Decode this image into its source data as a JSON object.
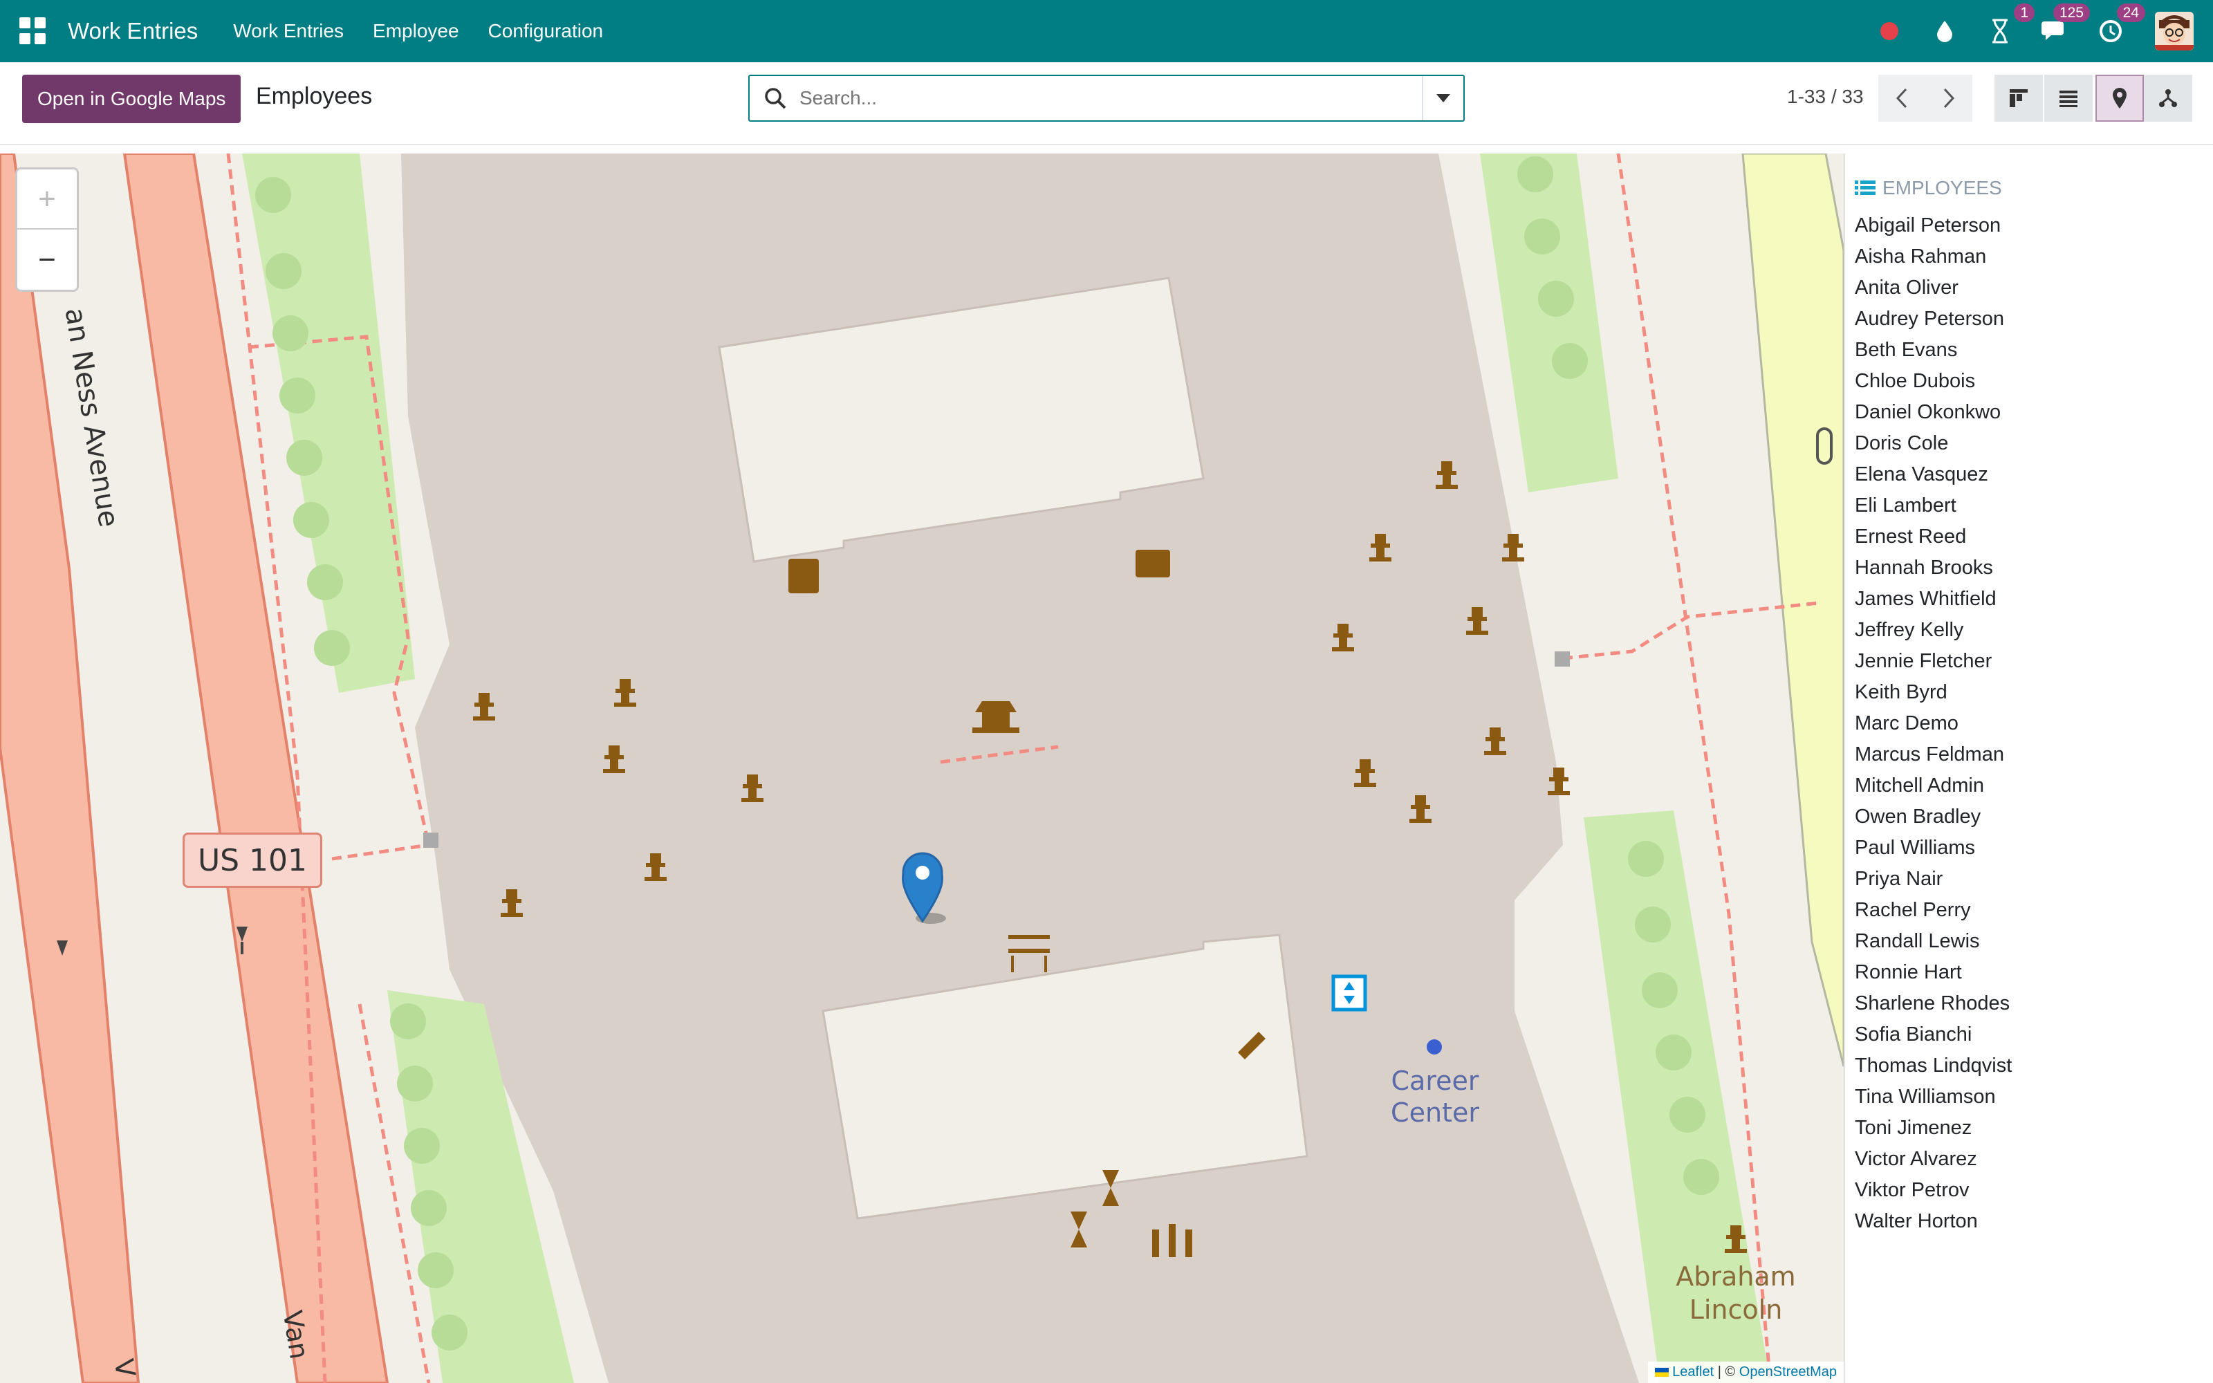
{
  "navbar": {
    "app_title": "Work Entries",
    "menus": [
      "Work Entries",
      "Employee",
      "Configuration"
    ],
    "badges": {
      "activities": "1",
      "messages": "125",
      "updates": "24"
    }
  },
  "control": {
    "gmaps_button": "Open in Google Maps",
    "breadcrumb": "Employees",
    "search_placeholder": "Search...",
    "pager": "1-33 / 33"
  },
  "map": {
    "road_label_1": "an Ness Avenue",
    "road_label_2": "Van",
    "road_label_3": "V",
    "shield": "US 101",
    "poi_1": "Career Center",
    "poi_2_line1": "Abraham",
    "poi_2_line2": "Lincoln",
    "zoom_in": "+",
    "zoom_out": "−",
    "attribution": {
      "leaflet": "Leaflet",
      "separator": " | © ",
      "osm": "OpenStreetMap"
    }
  },
  "sidebar": {
    "title": "EMPLOYEES",
    "employees": [
      "Abigail Peterson",
      "Aisha Rahman",
      "Anita Oliver",
      "Audrey Peterson",
      "Beth Evans",
      "Chloe Dubois",
      "Daniel Okonkwo",
      "Doris Cole",
      "Elena Vasquez",
      "Eli Lambert",
      "Ernest Reed",
      "Hannah Brooks",
      "James Whitfield",
      "Jeffrey Kelly",
      "Jennie Fletcher",
      "Keith Byrd",
      "Marc Demo",
      "Marcus Feldman",
      "Mitchell Admin",
      "Owen Bradley",
      "Paul Williams",
      "Priya Nair",
      "Rachel Perry",
      "Randall Lewis",
      "Ronnie Hart",
      "Sharlene Rhodes",
      "Sofia Bianchi",
      "Thomas Lindqvist",
      "Tina Williamson",
      "Toni Jimenez",
      "Victor Alvarez",
      "Viktor Petrov",
      "Walter Horton"
    ]
  },
  "colors": {
    "navbar": "#017e84",
    "primary": "#71396a",
    "marker": "#2a81cb",
    "poi": "#8b5a12"
  }
}
